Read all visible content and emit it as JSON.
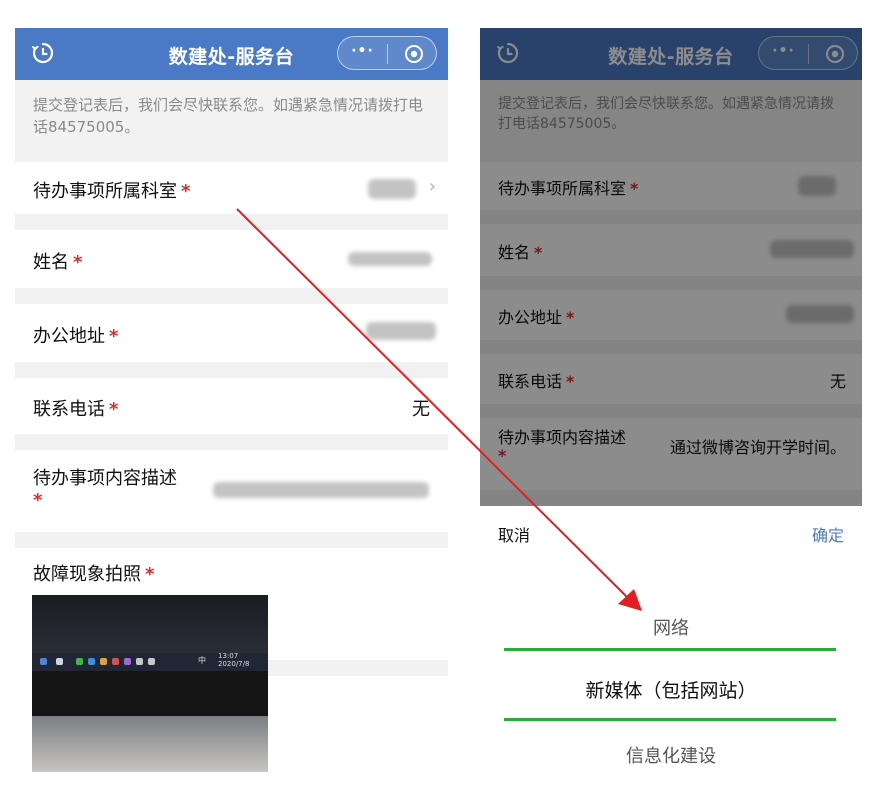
{
  "title": "数建处-服务台",
  "notice": "提交登记表后，我们会尽快联系您。如遇紧急情况请拨打电话84575005。",
  "required_mark": "*",
  "form": {
    "dept_label": "待办事项所属科室",
    "name_label": "姓名",
    "address_label": "办公地址",
    "phone_label": "联系电话",
    "phone_value": "无",
    "desc_label": "待办事项内容描述",
    "desc_value": "通过微博咨询开学时间。",
    "photo_label": "故障现象拍照"
  },
  "photo": {
    "time": "13:07",
    "date": "2020/7/8",
    "ime": "中"
  },
  "picker": {
    "cancel": "取消",
    "confirm": "确定",
    "options": [
      "网络",
      "新媒体（包括网站）",
      "信息化建设"
    ],
    "selected_index": 1
  },
  "colors": {
    "titlebar": "#4a79c5",
    "required": "#d62d2d",
    "confirm": "#4a79c5",
    "selection_line": "#2aae3b",
    "arrow": "#e02020"
  },
  "icons": {
    "clock": "clock-icon",
    "more": "more-dots-icon",
    "target": "target-icon",
    "chevron": "chevron-right-icon"
  }
}
